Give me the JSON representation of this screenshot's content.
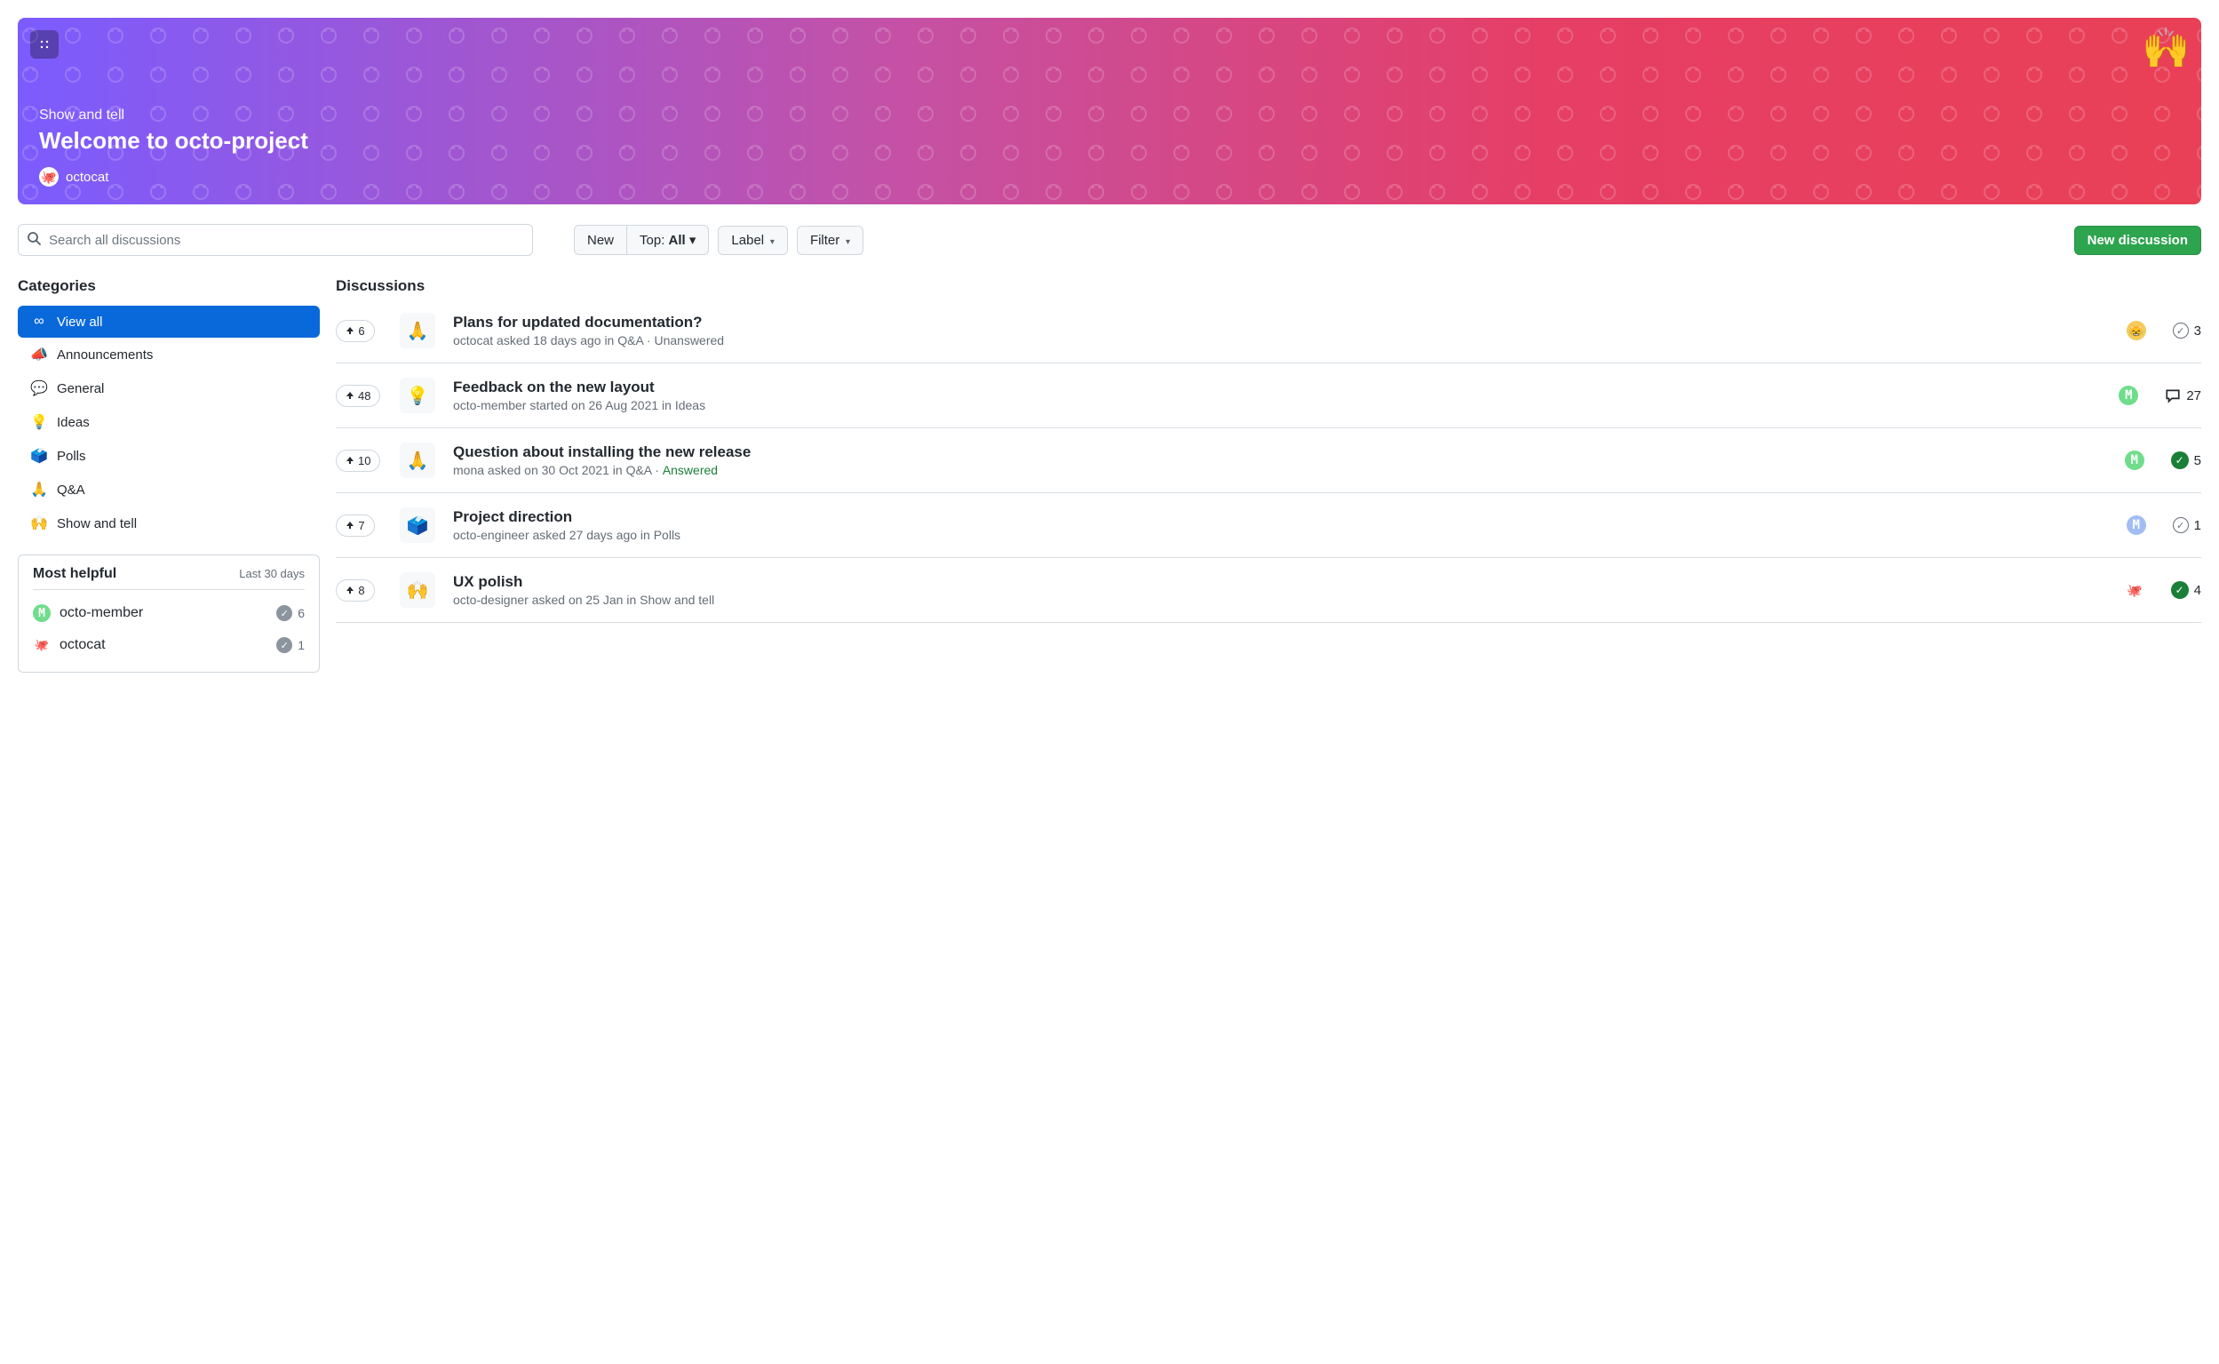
{
  "banner": {
    "category": "Show and tell",
    "title": "Welcome to octo-project",
    "author": "octocat",
    "emoji": "🙌"
  },
  "toolbar": {
    "search_placeholder": "Search all discussions",
    "new_label": "New",
    "top_prefix": "Top: ",
    "top_value": "All",
    "label_label": "Label",
    "filter_label": "Filter",
    "new_discussion_label": "New discussion"
  },
  "sidebar": {
    "title": "Categories",
    "categories": [
      {
        "icon": "∞",
        "label": "View all",
        "active": true
      },
      {
        "icon": "📣",
        "label": "Announcements"
      },
      {
        "icon": "💬",
        "label": "General"
      },
      {
        "icon": "💡",
        "label": "Ideas"
      },
      {
        "icon": "🗳️",
        "label": "Polls"
      },
      {
        "icon": "🙏",
        "label": "Q&A"
      },
      {
        "icon": "🙌",
        "label": "Show and tell"
      }
    ],
    "helpful": {
      "title": "Most helpful",
      "subtitle": "Last 30 days",
      "rows": [
        {
          "name": "octo-member",
          "count": "6",
          "avatar": "green"
        },
        {
          "name": "octocat",
          "count": "1",
          "avatar": "white"
        }
      ]
    }
  },
  "discussions": {
    "title": "Discussions",
    "items": [
      {
        "upvotes": "6",
        "icon": "🙏",
        "title": "Plans for updated documentation?",
        "meta": "octocat asked 18 days ago in Q&A · ",
        "status": "Unanswered",
        "status_class": "unanswered",
        "avatar": "yellow",
        "right_icon": "check-outline",
        "right_count": "3"
      },
      {
        "upvotes": "48",
        "icon": "💡",
        "title": "Feedback on the new layout",
        "meta": "octo-member started on 26 Aug 2021 in Ideas",
        "status": "",
        "status_class": "",
        "avatar": "green",
        "right_icon": "comment",
        "right_count": "27"
      },
      {
        "upvotes": "10",
        "icon": "🙏",
        "title": "Question about installing the new release",
        "meta": "mona asked on 30 Oct 2021 in Q&A · ",
        "status": "Answered",
        "status_class": "answered",
        "avatar": "green",
        "right_icon": "check-badge",
        "right_count": "5"
      },
      {
        "upvotes": "7",
        "icon": "🗳️",
        "title": "Project direction",
        "meta": "octo-engineer asked 27 days ago in Polls",
        "status": "",
        "status_class": "",
        "avatar": "blue",
        "right_icon": "check-outline",
        "right_count": "1"
      },
      {
        "upvotes": "8",
        "icon": "🙌",
        "title": "UX polish",
        "meta": "octo-designer asked on 25 Jan in Show and tell",
        "status": "",
        "status_class": "",
        "avatar": "white",
        "right_icon": "check-badge",
        "right_count": "4"
      }
    ]
  }
}
